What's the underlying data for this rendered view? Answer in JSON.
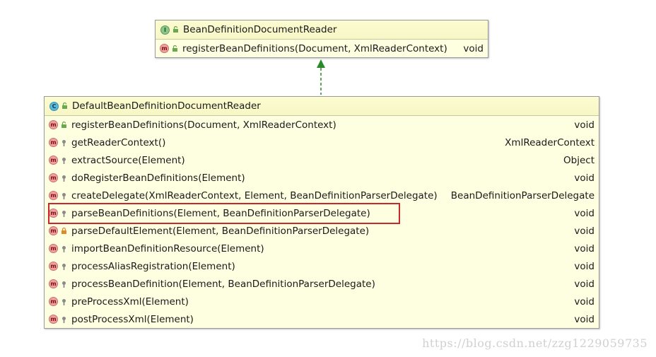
{
  "interface": {
    "badge": "I",
    "name": "BeanDefinitionDocumentReader",
    "methods": [
      {
        "badge": "m",
        "visibility": "public",
        "name": "registerBeanDefinitions(Document, XmlReaderContext)",
        "type": "void"
      }
    ]
  },
  "class": {
    "badge": "C",
    "name": "DefaultBeanDefinitionDocumentReader",
    "methods": [
      {
        "badge": "m",
        "visibility": "public",
        "name": "registerBeanDefinitions(Document, XmlReaderContext)",
        "type": "void"
      },
      {
        "badge": "m",
        "visibility": "protected",
        "name": "getReaderContext()",
        "type": "XmlReaderContext"
      },
      {
        "badge": "m",
        "visibility": "protected",
        "name": "extractSource(Element)",
        "type": "Object"
      },
      {
        "badge": "m",
        "visibility": "protected",
        "name": "doRegisterBeanDefinitions(Element)",
        "type": "void"
      },
      {
        "badge": "m",
        "visibility": "protected",
        "name": "createDelegate(XmlReaderContext, Element, BeanDefinitionParserDelegate)",
        "type": "BeanDefinitionParserDelegate"
      },
      {
        "badge": "m",
        "visibility": "protected",
        "name": "parseBeanDefinitions(Element, BeanDefinitionParserDelegate)",
        "type": "void"
      },
      {
        "badge": "m",
        "visibility": "private",
        "name": "parseDefaultElement(Element, BeanDefinitionParserDelegate)",
        "type": "void"
      },
      {
        "badge": "m",
        "visibility": "protected",
        "name": "importBeanDefinitionResource(Element)",
        "type": "void"
      },
      {
        "badge": "m",
        "visibility": "protected",
        "name": "processAliasRegistration(Element)",
        "type": "void"
      },
      {
        "badge": "m",
        "visibility": "protected",
        "name": "processBeanDefinition(Element, BeanDefinitionParserDelegate)",
        "type": "void"
      },
      {
        "badge": "m",
        "visibility": "protected",
        "name": "preProcessXml(Element)",
        "type": "void"
      },
      {
        "badge": "m",
        "visibility": "protected",
        "name": "postProcessXml(Element)",
        "type": "void"
      }
    ]
  },
  "relation": {
    "kind": "implements",
    "color": "#2a8a2a"
  },
  "highlighted_method": "parseBeanDefinitions(Element, BeanDefinitionParserDelegate)",
  "watermark": "https://blog.csdn.net/zzg1229059735",
  "colors": {
    "box_fill": "#fefee0",
    "highlight": "#c8282a",
    "arrow": "#2a8a2a"
  }
}
